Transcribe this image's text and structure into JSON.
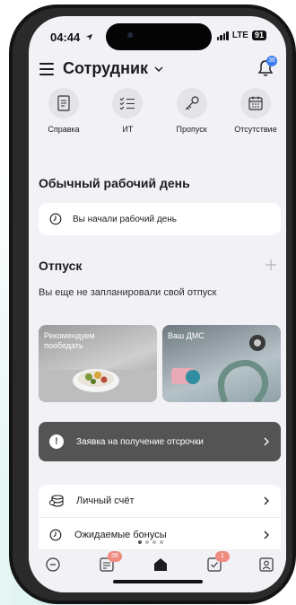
{
  "status_bar": {
    "time": "04:44",
    "network": "LTE",
    "battery": "91"
  },
  "header": {
    "title": "Сотрудник",
    "notifications_badge": "36"
  },
  "quick_actions": [
    {
      "label": "Справка",
      "icon": "document-icon"
    },
    {
      "label": "ИТ",
      "icon": "checklist-icon"
    },
    {
      "label": "Пропуск",
      "icon": "key-icon"
    },
    {
      "label": "Отсутствие",
      "icon": "calendar-icon"
    }
  ],
  "workday": {
    "title": "Обычный рабочий день",
    "status": "Вы начали рабочий день"
  },
  "vacation": {
    "title": "Отпуск",
    "empty_text": "Вы еще не запланировали свой отпуск"
  },
  "promos": [
    {
      "label": "Рекомендуем пообедать"
    },
    {
      "label": "Ваш ДМС"
    }
  ],
  "deferral_banner": {
    "text": "Заявка на получение отсрочки"
  },
  "list": [
    {
      "label": "Личный счёт"
    },
    {
      "label": "Ожидаемые бонусы"
    }
  ],
  "tabbar": {
    "tasks_badge": "36",
    "approvals_badge": "1"
  },
  "colors": {
    "accent": "#3d7cf0",
    "badge": "#f08b80",
    "banner": "#545454",
    "background": "#f2f1f6"
  }
}
